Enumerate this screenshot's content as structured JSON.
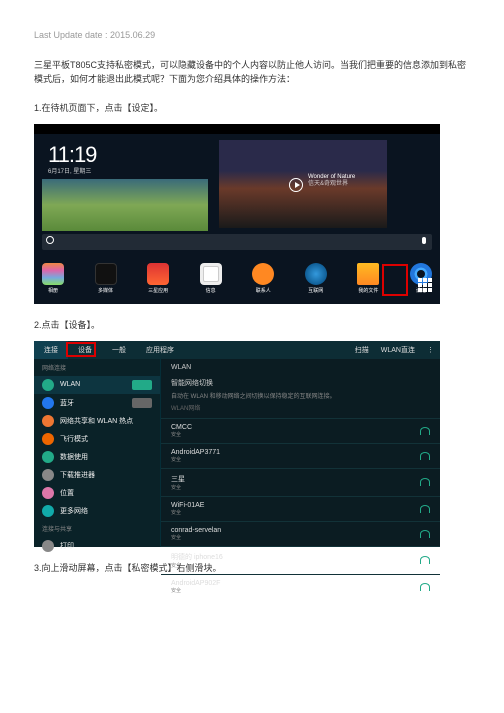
{
  "meta": {
    "update_label": "Last Update date : 2015.06.29"
  },
  "intro": "三星平板T805C支持私密模式，可以隐藏设备中的个人内容以防止他人访问。当我们把重要的信息添加到私密模式后，如何才能退出此模式呢？下面为您介绍具体的操作方法：",
  "steps": {
    "s1": "1.在待机页面下，点击【设定】。",
    "s2": "2.点击【设备】。",
    "s3": "3.向上滑动屏幕，点击【私密模式】右侧滑块。"
  },
  "homescreen": {
    "time": "11:19",
    "date": "6月17日, 星期三",
    "video_title": "Wonder of Nature",
    "video_subtitle": "信天&奇观世界",
    "dock": [
      {
        "key": "gallery",
        "label": "相册"
      },
      {
        "key": "media",
        "label": "多媒体"
      },
      {
        "key": "store",
        "label": "三星应用"
      },
      {
        "key": "msg",
        "label": "信息"
      },
      {
        "key": "contacts",
        "label": "联系人"
      },
      {
        "key": "browser",
        "label": "互联网"
      },
      {
        "key": "files",
        "label": "我的文件"
      },
      {
        "key": "settings",
        "label": "设定"
      }
    ]
  },
  "settings": {
    "tabs": {
      "t1": "连接",
      "t2": "设备",
      "t3": "一般",
      "t4": "应用程序"
    },
    "scan": "扫描",
    "wlan_direct": "WLAN直连",
    "side_header": "网络连接",
    "side": {
      "wlan": "WLAN",
      "bluetooth": "蓝牙",
      "hotspot": "网络共享和 WLAN 热点",
      "airplane": "飞行模式",
      "data": "数据使用",
      "download": "下载推进器",
      "location": "位置",
      "more": "更多网络",
      "print": "打印"
    },
    "main": {
      "title": "WLAN",
      "smart_title": "智能网络切换",
      "smart_sub": "自动在 WLAN 和移动网络之间切换以保持稳定的互联网连接。",
      "networks_header": "WLAN网络",
      "networks": [
        {
          "name": "CMCC",
          "sub": "安全"
        },
        {
          "name": "AndroidAP3771",
          "sub": "安全"
        },
        {
          "name": "三星",
          "sub": "安全"
        },
        {
          "name": "WiFi-01AE",
          "sub": "安全"
        },
        {
          "name": "conrad-servelan",
          "sub": "安全"
        },
        {
          "name": "明德的 iphone16",
          "sub": "安全"
        },
        {
          "name": "AndroidAP902F",
          "sub": "安全"
        }
      ]
    }
  }
}
